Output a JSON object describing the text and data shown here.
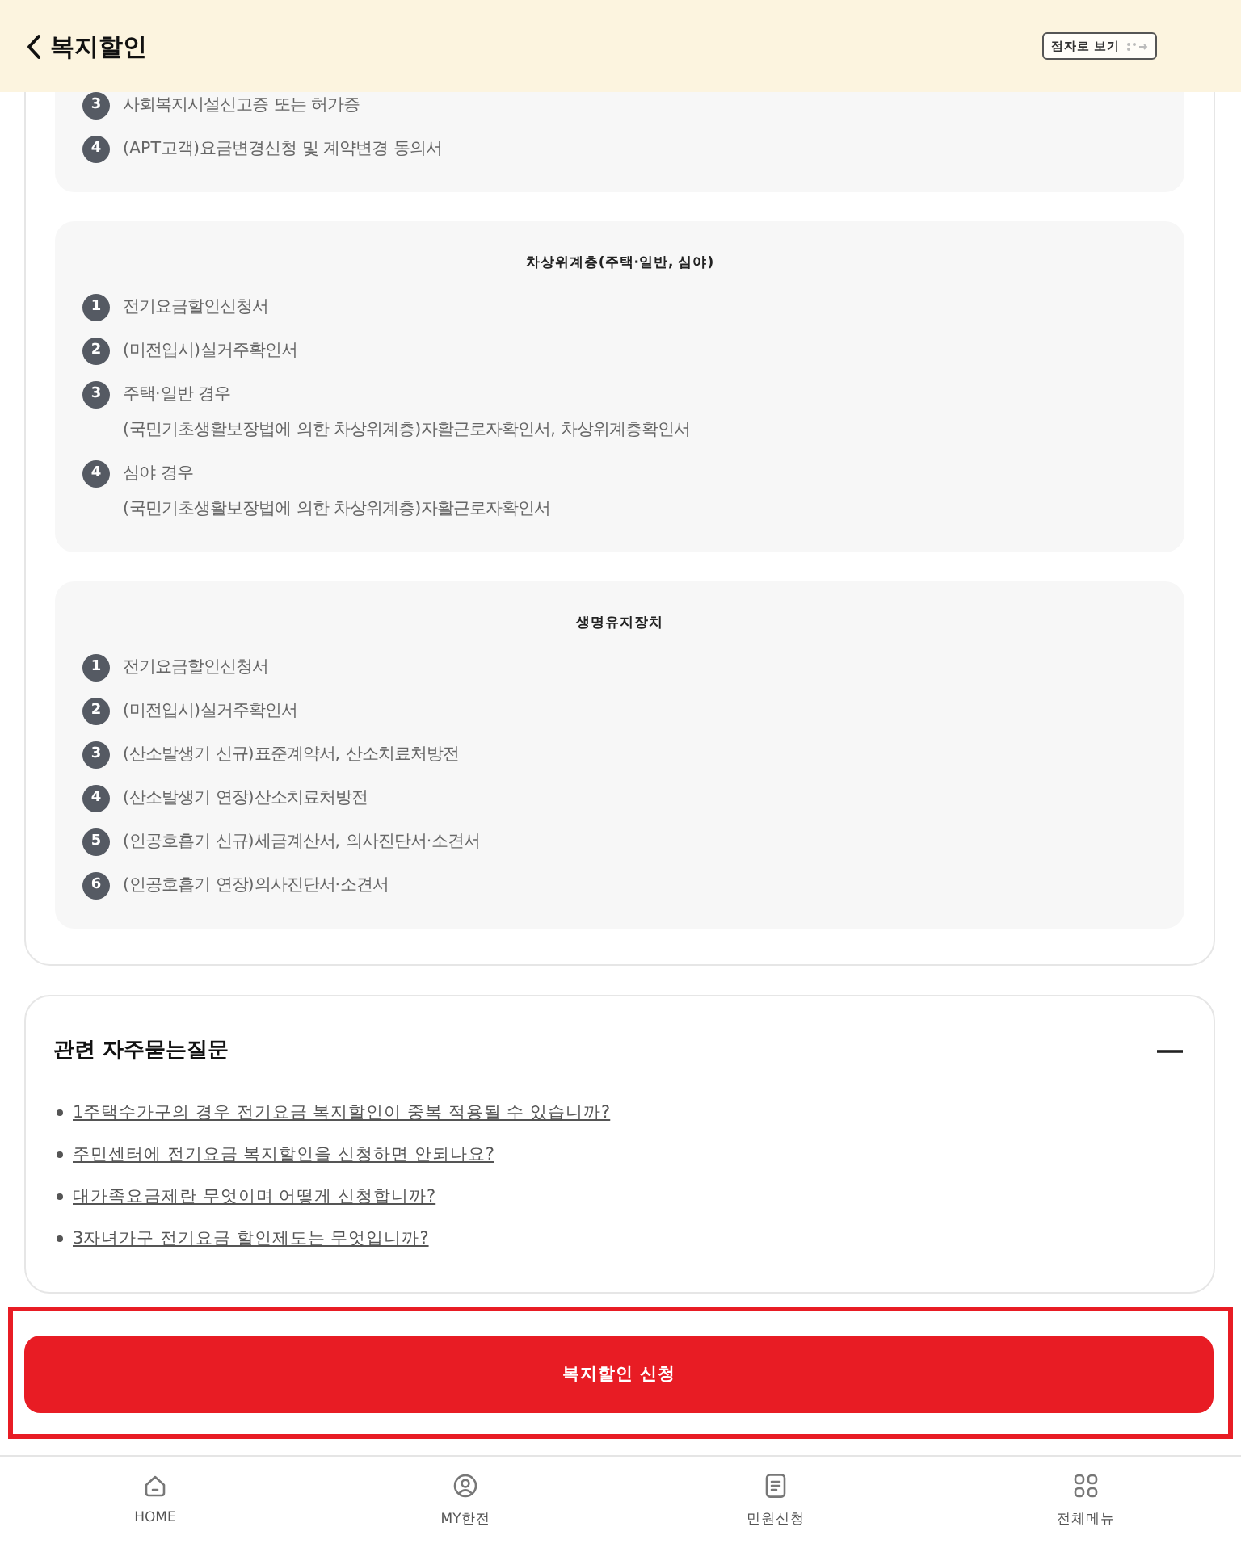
{
  "header": {
    "title": "복지할인",
    "braille_button": "점자로 보기"
  },
  "document_groups": [
    {
      "items": [
        {
          "number": "3",
          "lines": [
            "사회복지시설신고증 또는 허가증"
          ]
        },
        {
          "number": "4",
          "lines": [
            "(APT고객)요금변경신청 및 계약변경 동의서"
          ]
        }
      ]
    },
    {
      "title": "차상위계층(주택·일반, 심야)",
      "items": [
        {
          "number": "1",
          "lines": [
            "전기요금할인신청서"
          ]
        },
        {
          "number": "2",
          "lines": [
            "(미전입시)실거주확인서"
          ]
        },
        {
          "number": "3",
          "lines": [
            "주택·일반 경우",
            "(국민기초생활보장법에 의한 차상위계층)자활근로자확인서, 차상위계층확인서"
          ]
        },
        {
          "number": "4",
          "lines": [
            "심야 경우",
            "(국민기초생활보장법에 의한 차상위계층)자활근로자확인서"
          ]
        }
      ]
    },
    {
      "title": "생명유지장치",
      "items": [
        {
          "number": "1",
          "lines": [
            "전기요금할인신청서"
          ]
        },
        {
          "number": "2",
          "lines": [
            "(미전입시)실거주확인서"
          ]
        },
        {
          "number": "3",
          "lines": [
            "(산소발생기 신규)표준계약서, 산소치료처방전"
          ]
        },
        {
          "number": "4",
          "lines": [
            "(산소발생기 연장)산소치료처방전"
          ]
        },
        {
          "number": "5",
          "lines": [
            "(인공호흡기 신규)세금계산서, 의사진단서·소견서"
          ]
        },
        {
          "number": "6",
          "lines": [
            "(인공호흡기 연장)의사진단서·소견서"
          ]
        }
      ]
    }
  ],
  "faq": {
    "title": "관련 자주묻는질문",
    "expanded": true,
    "links": [
      "1주택수가구의 경우 전기요금 복지할인이 중복 적용될 수 있습니까?",
      "주민센터에 전기요금 복지할인을 신청하면 안되나요?",
      "대가족요금제란 무엇이며 어떻게 신청합니까?",
      "3자녀가구 전기요금 할인제도는 무엇입니까?"
    ]
  },
  "apply_button": {
    "label": "복지할인 신청",
    "highlighted": true
  },
  "bottom_nav": [
    {
      "label": "HOME"
    },
    {
      "label": "MY한전"
    },
    {
      "label": "민원신청"
    },
    {
      "label": "전체메뉴"
    }
  ]
}
